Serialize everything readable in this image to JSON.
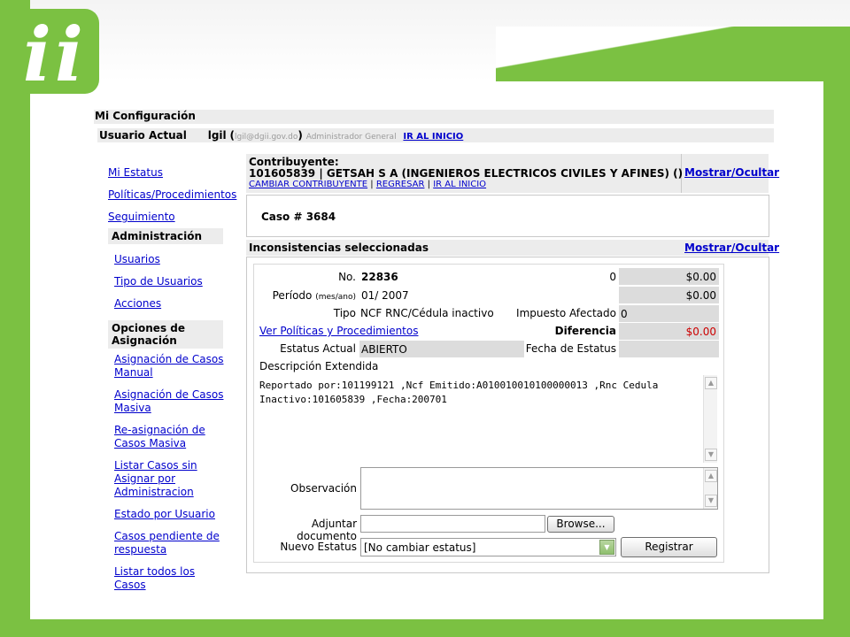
{
  "header": {
    "section_title": "Mi Configuración",
    "user_label": "Usuario Actual",
    "user_name": "lgil",
    "user_paren_open": "(",
    "user_email": "lgil@dgii.gov.do",
    "user_paren_close": ")",
    "user_role": "Administrador General",
    "home_link": "IR AL INICIO"
  },
  "sidebar": {
    "top_links": [
      "Mi Estatus",
      "Políticas/Procedimientos",
      "Seguimiento"
    ],
    "admin_title": "Administración",
    "admin_links": [
      "Usuarios",
      "Tipo de Usuarios",
      "Acciones"
    ],
    "assign_title": "Opciones de Asignación",
    "assign_links": [
      "Asignación de Casos Manual",
      "Asignación de Casos Masiva",
      "Re-asignación de Casos Masiva",
      "Listar Casos sin Asignar por Administracion",
      "Estado por Usuario",
      "Casos pendiente de respuesta",
      "Listar todos los Casos"
    ]
  },
  "taxpayer": {
    "label": "Contribuyente:",
    "value": "101605839 | GETSAH S A (INGENIEROS ELECTRICOS CIVILES Y AFINES) ()",
    "link_change": "CAMBIAR CONTRIBUYENTE",
    "sep": "|",
    "link_back": "REGRESAR",
    "link_home": "IR AL INICIO",
    "toggle": "Mostrar/Ocultar"
  },
  "case": {
    "title": "Caso # 3684"
  },
  "inconsistencies": {
    "title": "Inconsistencias seleccionadas",
    "toggle": "Mostrar/Ocultar",
    "no_label": "No.",
    "no_value": "22836",
    "no_amount_left": "0",
    "no_amount_right": "$0.00",
    "period_label": "Período",
    "period_hint": "(mes/ano)",
    "period_value": "01/ 2007",
    "period_amount": "$0.00",
    "type_label": "Tipo",
    "type_value": "NCF RNC/Cédula inactivo",
    "impuesto_label": "Impuesto Afectado",
    "impuesto_value": "0",
    "policies_link": "Ver Políticas y Procedimientos",
    "diferencia_label": "Diferencia",
    "diferencia_value": "$0.00",
    "status_label": "Estatus Actual",
    "status_value": "ABIERTO",
    "status_date_label": "Fecha de Estatus",
    "status_date_value": "",
    "desc_label": "Descripción Extendida",
    "desc_text": "Reportado por:101199121  ,Ncf Emitido:A010010010100000013  ,Rnc Cedula Inactivo:101605839  ,Fecha:200701",
    "obs_label": "Observación",
    "obs_value": "",
    "attach_label": "Adjuntar documento",
    "attach_value": "",
    "browse_label": "Browse...",
    "new_status_label": "Nuevo Estatus",
    "new_status_value": "[No cambiar estatus]",
    "register_label": "Registrar"
  },
  "colors": {
    "brand_green": "#7bc142",
    "link_blue": "#0000cc",
    "diff_red": "#cc0000"
  }
}
